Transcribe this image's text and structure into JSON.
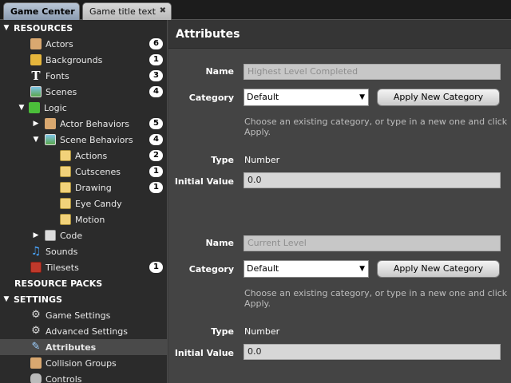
{
  "tabs": [
    {
      "label": "Game Center"
    },
    {
      "label": "Game title text",
      "close": "✖"
    }
  ],
  "sidebar": {
    "resources_header": "RESOURCES",
    "actors": {
      "label": "Actors",
      "count": "6"
    },
    "backgrounds": {
      "label": "Backgrounds",
      "count": "1"
    },
    "fonts": {
      "label": "Fonts",
      "count": "3"
    },
    "scenes": {
      "label": "Scenes",
      "count": "4"
    },
    "logic": {
      "label": "Logic"
    },
    "actor_behaviors": {
      "label": "Actor Behaviors",
      "count": "5"
    },
    "scene_behaviors": {
      "label": "Scene Behaviors",
      "count": "4"
    },
    "actions": {
      "label": "Actions",
      "count": "2"
    },
    "cutscenes": {
      "label": "Cutscenes",
      "count": "1"
    },
    "drawing": {
      "label": "Drawing",
      "count": "1"
    },
    "eye_candy": {
      "label": "Eye Candy"
    },
    "motion": {
      "label": "Motion"
    },
    "code": {
      "label": "Code"
    },
    "sounds": {
      "label": "Sounds"
    },
    "tilesets": {
      "label": "Tilesets",
      "count": "1"
    },
    "resource_packs_header": "RESOURCE PACKS",
    "settings_header": "SETTINGS",
    "game_settings": {
      "label": "Game Settings"
    },
    "advanced_settings": {
      "label": "Advanced Settings"
    },
    "attributes": {
      "label": "Attributes"
    },
    "collision_groups": {
      "label": "Collision Groups"
    },
    "controls": {
      "label": "Controls"
    }
  },
  "main": {
    "title": "Attributes",
    "attributes": [
      {
        "name_label": "Name",
        "name_value": "Highest Level Completed",
        "category_label": "Category",
        "category_value": "Default",
        "apply_button": "Apply New Category",
        "hint": "Choose an existing category, or type in a new one and click Apply.",
        "type_label": "Type",
        "type_value": "Number",
        "initial_label": "Initial Value",
        "initial_value": "0.0"
      },
      {
        "name_label": "Name",
        "name_value": "Current Level",
        "category_label": "Category",
        "category_value": "Default",
        "apply_button": "Apply New Category",
        "hint": "Choose an existing category, or type in a new one and click Apply.",
        "type_label": "Type",
        "type_value": "Number",
        "initial_label": "Initial Value",
        "initial_value": "0.0"
      }
    ]
  },
  "icons": {
    "expanded": "▼",
    "collapsed": "▶",
    "dropdown": "▼"
  },
  "colors": {
    "sidebar_bg": "#2b2b2b",
    "main_bg": "#444444",
    "selected_row": "#4a4a4a",
    "active_tab": "#9aaabd"
  }
}
